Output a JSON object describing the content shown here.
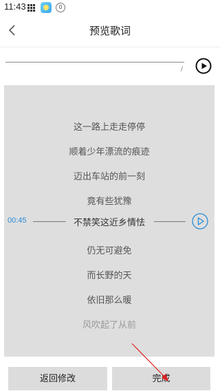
{
  "status_bar": {
    "time": "11:43",
    "badge_count": "0"
  },
  "nav": {
    "title": "预览歌词",
    "back_icon": "chevron-left-icon"
  },
  "player": {
    "play_icon": "play-circle-icon"
  },
  "lyrics": {
    "lines_before": [
      "这一路上走走停停",
      "顺着少年漂流的痕迹",
      "迈出车站的前一刻",
      "竟有些犹豫"
    ],
    "current": {
      "time": "00:45",
      "text": "不禁笑这近乡情怯"
    },
    "lines_after": [
      "仍无可避免",
      "而长野的天",
      "依旧那么暖"
    ],
    "faded_line": "风吹起了从前"
  },
  "footer": {
    "back_edit_label": "返回修改",
    "done_label": "完成"
  },
  "colors": {
    "accent": "#2a8bd6",
    "panel": "#dedede",
    "annotation": "#e02020"
  }
}
